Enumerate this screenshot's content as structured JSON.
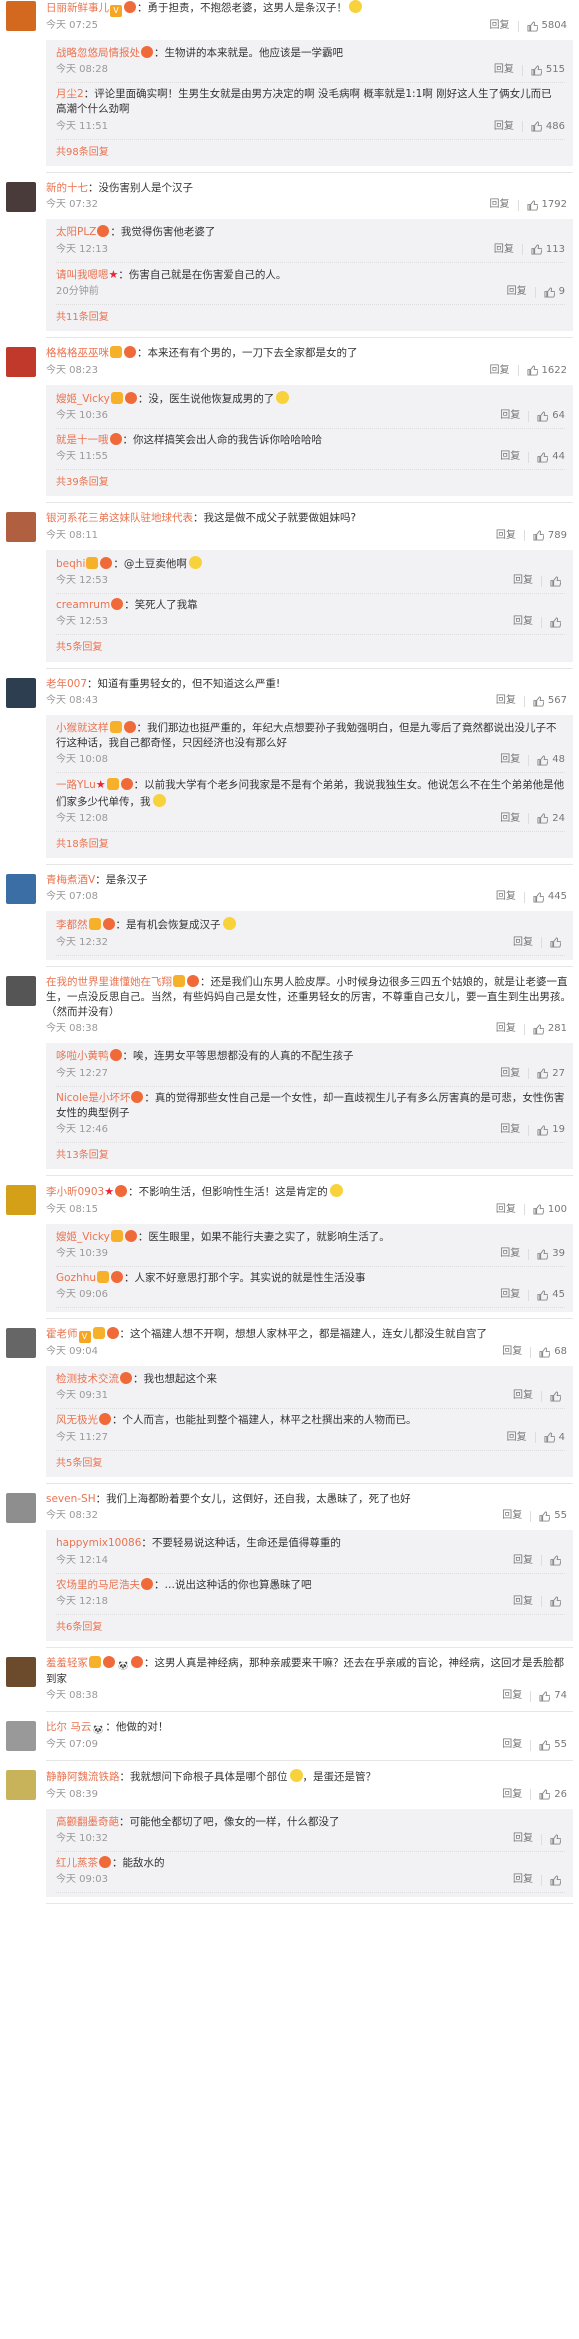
{
  "ui": {
    "reply": "回复",
    "more_suffix": "条回复"
  },
  "colors": {
    "username": "#eb7350",
    "meta": "#999999",
    "sub_bg": "#f2f2f5",
    "vip": "#f6b02a",
    "level": "#f06a39"
  },
  "comments": [
    {
      "user": "日丽新鲜事儿",
      "badges": [
        "vv",
        "lv"
      ],
      "text": "勇于担责，不抱怨老婆，这男人是条汉子！",
      "emoji": true,
      "time": "今天 07:25",
      "likes": "5804",
      "avatar": "#d2691e",
      "subs": [
        {
          "user": "战略忽悠局情报处",
          "badges": [
            "lv"
          ],
          "text": "生物讲的本来就是。他应该是一学霸吧",
          "time": "今天 08:28",
          "likes": "515"
        },
        {
          "user": "月尘2",
          "badges": [],
          "text": "评论里面确实啊！生男生女就是由男方决定的啊 没毛病啊 概率就是1:1啊 刚好这人生了俩女儿而已 高潮个什么劲啊",
          "time": "今天 11:51",
          "likes": "486"
        }
      ],
      "more": "共98条回复"
    },
    {
      "user": "新的十七",
      "badges": [],
      "text": "没伤害别人是个汉子",
      "time": "今天 07:32",
      "likes": "1792",
      "avatar": "#4a3b3b",
      "subs": [
        {
          "user": "太阳PLZ",
          "badges": [
            "lv"
          ],
          "text": "我觉得伤害他老婆了",
          "time": "今天 12:13",
          "likes": "113"
        },
        {
          "user": "请叫我嗯嗯",
          "badges": [
            "star"
          ],
          "text": "伤害自己就是在伤害爱自己的人。",
          "time": "20分钟前",
          "likes": "9"
        }
      ],
      "more": "共11条回复"
    },
    {
      "user": "格格格巫巫咪",
      "badges": [
        "vip",
        "lv"
      ],
      "text": "本来还有有个男的，一刀下去全家都是女的了",
      "time": "今天 08:23",
      "likes": "1622",
      "avatar": "#c0392b",
      "subs": [
        {
          "user": "嫂姬_Vicky",
          "badges": [
            "vip",
            "lv"
          ],
          "text": "没，医生说他恢复成男的了",
          "emoji": true,
          "time": "今天 10:36",
          "likes": "64"
        },
        {
          "user": "就是十一哦",
          "badges": [
            "lv"
          ],
          "text": "你这样搞笑会出人命的我告诉你哈哈哈哈",
          "time": "今天 11:55",
          "likes": "44"
        }
      ],
      "more": "共39条回复"
    },
    {
      "user": "银河系花三弟这妹队驻地球代表",
      "badges": [],
      "text": "我这是做不成父子就要做姐妹吗?",
      "time": "今天 08:11",
      "likes": "789",
      "avatar": "#b06040",
      "subs": [
        {
          "user": "beqhi",
          "badges": [
            "vip",
            "lv"
          ],
          "text": "@土豆卖他啊",
          "emoji": true,
          "time": "今天 12:53",
          "likes": ""
        },
        {
          "user": "creamrum",
          "badges": [
            "lv"
          ],
          "text": "笑死人了我靠",
          "time": "今天 12:53",
          "likes": ""
        }
      ],
      "more": "共5条回复"
    },
    {
      "user": "老年007",
      "badges": [],
      "text": "知道有重男轻女的，但不知道这么严重!",
      "time": "今天 08:43",
      "likes": "567",
      "avatar": "#2c3e50",
      "subs": [
        {
          "user": "小猴就这样",
          "badges": [
            "vip",
            "lv"
          ],
          "text": "我们那边也挺严重的，年纪大点想要孙子我勉强明白，但是九零后了竟然都说出没儿子不行这种话，我自己都奇怪，只因经济也没有那么好",
          "time": "今天 10:08",
          "likes": "48"
        },
        {
          "user": "一路YLu",
          "badges": [
            "star",
            "vip",
            "lv"
          ],
          "text": "以前我大学有个老乡问我家是不是有个弟弟，我说我独生女。他说怎么不在生个弟弟他是他们家多少代单传，我",
          "emoji": true,
          "time": "今天 12:08",
          "likes": "24"
        }
      ],
      "more": "共18条回复"
    },
    {
      "user": "青梅煮酒V",
      "badges": [],
      "text": "是条汉子",
      "time": "今天 07:08",
      "likes": "445",
      "avatar": "#3b6ea5",
      "subs": [
        {
          "user": "李都然",
          "badges": [
            "vip",
            "lv"
          ],
          "text": "是有机会恢复成汉子",
          "emoji": true,
          "time": "今天 12:32",
          "likes": ""
        }
      ],
      "more": ""
    },
    {
      "user": "在我的世界里谁懂她在飞翔",
      "badges": [
        "vip",
        "lv"
      ],
      "text": "还是我们山东男人脸皮厚。小时候身边很多三四五个姑娘的，就是让老婆一直生，一点没反思自己。当然，有些妈妈自己是女性，还重男轻女的厉害，不尊重自己女儿，要一直生到生出男孩。（然而并没有）",
      "time": "今天 08:38",
      "likes": "281",
      "avatar": "#555",
      "subs": [
        {
          "user": "哆啦小黄鸭",
          "badges": [
            "lv"
          ],
          "text": "唉，连男女平等思想都没有的人真的不配生孩子",
          "time": "今天 12:27",
          "likes": "27"
        },
        {
          "user": "Nicole是小坏坏",
          "badges": [
            "lv"
          ],
          "text": "真的觉得那些女性自己是一个女性，却一直歧视生儿子有多么厉害真的是可悲，女性伤害女性的典型例子",
          "time": "今天 12:46",
          "likes": "19"
        }
      ],
      "more": "共13条回复"
    },
    {
      "user": "李小昕0903",
      "badges": [
        "star",
        "lv"
      ],
      "text": "不影响生活，但影响性生活！这是肯定的",
      "emoji": true,
      "time": "今天 08:15",
      "likes": "100",
      "avatar": "#d4a017",
      "subs": [
        {
          "user": "嫂姬_Vicky",
          "badges": [
            "vip",
            "lv"
          ],
          "text": "医生眼里，如果不能行夫妻之实了，就影响生活了。",
          "time": "今天 10:39",
          "likes": "39"
        },
        {
          "user": "Gozhhu",
          "badges": [
            "vip",
            "lv"
          ],
          "text": "人家不好意思打那个字。其实说的就是性生活没事",
          "time": "今天 09:06",
          "likes": "45"
        }
      ],
      "more": ""
    },
    {
      "user": "霍老师",
      "badges": [
        "vv",
        "vip",
        "lv"
      ],
      "text": "这个福建人想不开啊，想想人家林平之，都是福建人，连女儿都没生就自宫了",
      "time": "今天 09:04",
      "likes": "68",
      "avatar": "#666",
      "subs": [
        {
          "user": "检测技术交流",
          "badges": [
            "lv"
          ],
          "text": "我也想起这个来",
          "time": "今天 09:31",
          "likes": ""
        },
        {
          "user": "风无极光",
          "badges": [
            "lv"
          ],
          "text": "个人而言，也能扯到整个福建人，林平之杜撰出来的人物而已。",
          "time": "今天 11:27",
          "likes": "4"
        }
      ],
      "more": "共5条回复"
    },
    {
      "user": "seven-SH",
      "badges": [],
      "text": "我们上海都盼着要个女儿，这倒好，还自我，太愚昧了，死了也好",
      "time": "今天 08:32",
      "likes": "55",
      "avatar": "#8e8e8e",
      "subs": [
        {
          "user": "happymix10086",
          "badges": [],
          "text": "不要轻易说这种话，生命还是值得尊重的",
          "time": "今天 12:14",
          "likes": ""
        },
        {
          "user": "农场里的马尼浩夫",
          "badges": [
            "lv"
          ],
          "text": "…说出这种话的你也算愚昧了吧",
          "time": "今天 12:18",
          "likes": ""
        }
      ],
      "more": "共6条回复"
    },
    {
      "user": "羞羞轻冢",
      "badges": [
        "vip",
        "lv",
        "panda",
        "lv"
      ],
      "text": "这男人真是神经病，那种亲戚要来干嘛？还去在乎亲戚的盲论，神经病，这回才是丢脸都到家",
      "time": "今天 08:38",
      "likes": "74",
      "avatar": "#6b4b2b",
      "subs": [],
      "more": ""
    },
    {
      "user": "比尔 马云",
      "badges": [
        "panda"
      ],
      "text": "他做的对！",
      "time": "今天 07:09",
      "likes": "55",
      "avatar": "#999",
      "subs": [],
      "more": ""
    },
    {
      "user": "静静阿魏流铁路",
      "badges": [],
      "text": "我就想问下命根子具体是哪个部位",
      "emoji": true,
      "text2": "，是蛋还是管？",
      "time": "今天 08:39",
      "likes": "26",
      "avatar": "#c9b35a",
      "subs": [
        {
          "user": "高颧翻墨奇葩",
          "badges": [],
          "text": "可能他全都切了吧，像女的一样，什么都没了",
          "time": "今天 10:32",
          "likes": ""
        },
        {
          "user": "红儿蒸茶",
          "badges": [
            "lv"
          ],
          "text": "能敌水的",
          "time": "今天 09:03",
          "likes": ""
        }
      ],
      "more": ""
    }
  ]
}
